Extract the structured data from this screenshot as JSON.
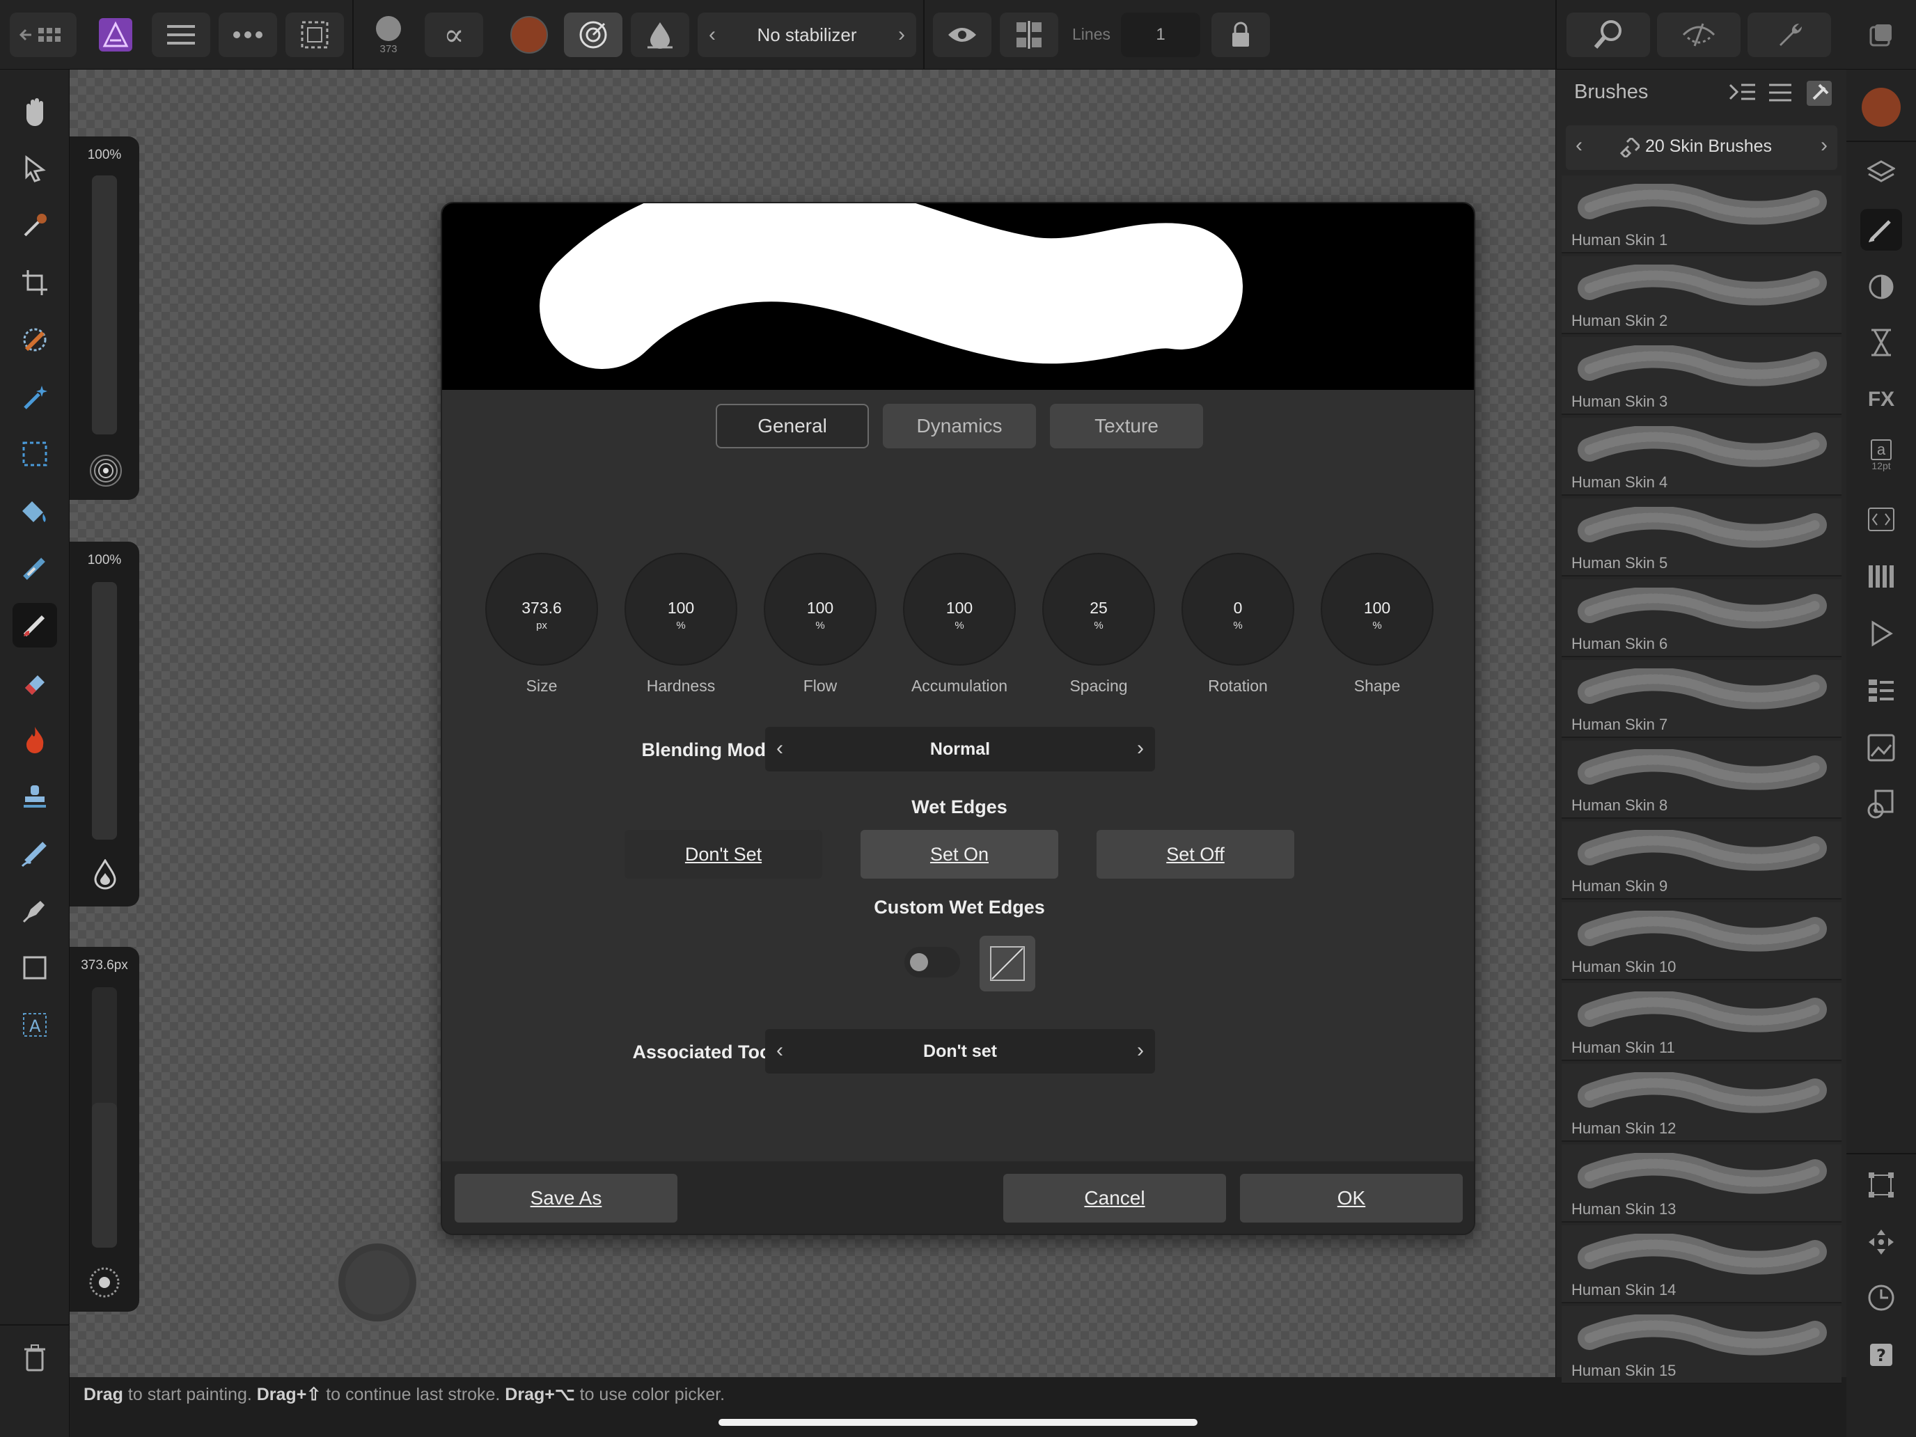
{
  "topbar": {
    "brush_size_badge": "373",
    "stabilizer": "No stabilizer",
    "lines_label": "Lines",
    "lines_value": "1",
    "color": "#8a3e22"
  },
  "sliders": {
    "opacity_label": "100%",
    "flow_label": "100%",
    "size_label": "373.6px"
  },
  "status": {
    "drag1": "Drag",
    "text1": " to start painting. ",
    "drag2": "Drag+⇧",
    "text2": " to continue last stroke. ",
    "drag3": "Drag+⌥",
    "text3": " to use color picker."
  },
  "brushes_panel": {
    "title": "Brushes",
    "category": "20 Skin Brushes",
    "items": [
      {
        "name": "Human Skin 1"
      },
      {
        "name": "Human Skin 2"
      },
      {
        "name": "Human Skin 3"
      },
      {
        "name": "Human Skin 4"
      },
      {
        "name": "Human Skin 5"
      },
      {
        "name": "Human Skin 6"
      },
      {
        "name": "Human Skin 7"
      },
      {
        "name": "Human Skin 8"
      },
      {
        "name": "Human Skin 9"
      },
      {
        "name": "Human Skin 10"
      },
      {
        "name": "Human Skin 11"
      },
      {
        "name": "Human Skin 12"
      },
      {
        "name": "Human Skin  13"
      },
      {
        "name": "Human Skin  14"
      },
      {
        "name": "Human Skin  15"
      }
    ]
  },
  "right_strip": {
    "text_icon_letter": "a",
    "text_icon_size": "12pt"
  },
  "dialog": {
    "tabs": [
      "General",
      "Dynamics",
      "Texture"
    ],
    "dials": [
      {
        "value": "373.6",
        "unit": "px",
        "label": "Size"
      },
      {
        "value": "100",
        "unit": "%",
        "label": "Hardness"
      },
      {
        "value": "100",
        "unit": "%",
        "label": "Flow"
      },
      {
        "value": "100",
        "unit": "%",
        "label": "Accumulation"
      },
      {
        "value": "25",
        "unit": "%",
        "label": "Spacing"
      },
      {
        "value": "0",
        "unit": "%",
        "label": "Rotation"
      },
      {
        "value": "100",
        "unit": "%",
        "label": "Shape"
      }
    ],
    "blending_mode_label": "Blending Mode",
    "blending_mode_value": "Normal",
    "wet_edges_label": "Wet Edges",
    "wet_edges_options": [
      "Don't Set",
      "Set On",
      "Set Off"
    ],
    "custom_wet_edges_label": "Custom Wet Edges",
    "associated_tool_label": "Associated Tool",
    "associated_tool_value": "Don't set",
    "save_as": "Save As",
    "cancel": "Cancel",
    "ok": "OK"
  }
}
